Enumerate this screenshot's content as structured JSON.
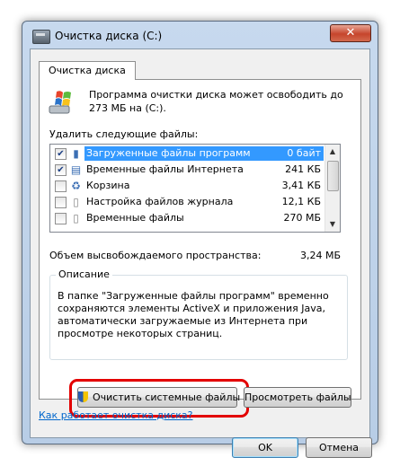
{
  "window": {
    "title": "Очистка диска  (C:)",
    "close_symbol": "✕",
    "accent_color": "#e30000"
  },
  "tab": {
    "label": "Очистка диска"
  },
  "intro": {
    "text": "Программа очистки диска может освободить до 273 МБ на  (C:)."
  },
  "files": {
    "section_label": "Удалить следующие файлы:",
    "rows": [
      {
        "checked": true,
        "name": "Загруженные файлы программ",
        "size": "0 байт",
        "selected": true,
        "icon": "folder-icon"
      },
      {
        "checked": true,
        "name": "Временные файлы Интернета",
        "size": "241 КБ",
        "selected": false,
        "icon": "ie-lock-icon"
      },
      {
        "checked": false,
        "name": "Корзина",
        "size": "3,41 КБ",
        "selected": false,
        "icon": "recycle-bin-icon"
      },
      {
        "checked": false,
        "name": "Настройка файлов журнала",
        "size": "12,1 КБ",
        "selected": false,
        "icon": "document-icon"
      },
      {
        "checked": false,
        "name": "Временные файлы",
        "size": "270 МБ",
        "selected": false,
        "icon": "document-icon"
      }
    ]
  },
  "space": {
    "label": "Объем высвобождаемого пространства:",
    "value": "3,24 МБ"
  },
  "description": {
    "label": "Описание",
    "text": "В папке \"Загруженные файлы программ\" временно сохраняются элементы ActiveX и приложения Java, автоматически загружаемые из Интернета при просмотре некоторых страниц."
  },
  "buttons": {
    "clean_system": "Очистить системные файлы",
    "view_files": "Просмотреть файлы",
    "ok": "OK",
    "cancel": "Отмена"
  },
  "link": {
    "text": "Как работает очистка диска?"
  }
}
